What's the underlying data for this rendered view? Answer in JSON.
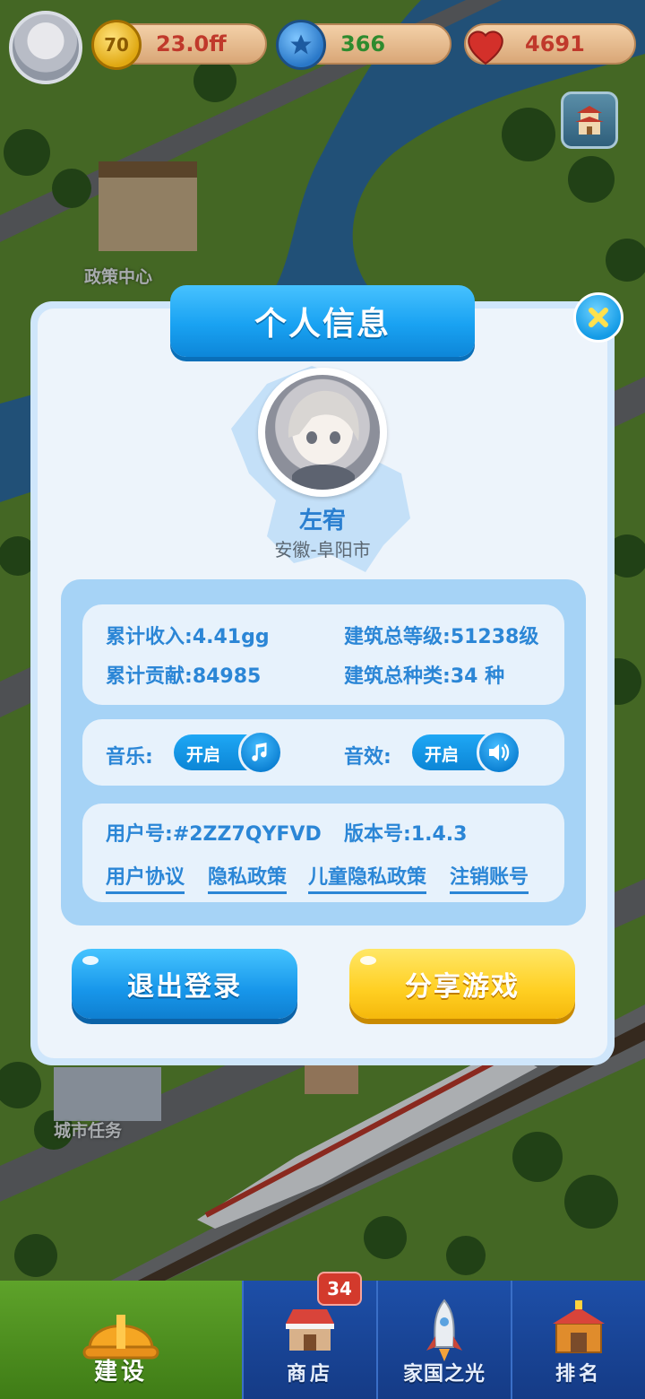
{
  "top_bar": {
    "coins": "23.0ff",
    "coin_icon_label": "70",
    "stars": "366",
    "hearts": "4691",
    "colors": {
      "coins": "#c0392b",
      "stars": "#2e8b2e",
      "hearts": "#c0392b"
    }
  },
  "map_labels": {
    "policy_center": "政策中心",
    "city_tasks": "城市任务"
  },
  "dialog": {
    "title": "个人信息",
    "player_name": "左宥",
    "location": "安徽-阜阳市",
    "stats": {
      "income_label": "累计收入:",
      "income_value": "4.41gg",
      "building_level_label": "建筑总等级:",
      "building_level_value": "51238级",
      "contribution_label": "累计贡献:",
      "contribution_value": "84985",
      "building_types_label": "建筑总种类:",
      "building_types_value": "34 种"
    },
    "settings": {
      "music_label": "音乐:",
      "music_state": "开启",
      "sfx_label": "音效:",
      "sfx_state": "开启"
    },
    "account": {
      "user_id_label": "用户号:",
      "user_id": "#2ZZ7QYFVD",
      "version_label": "版本号:",
      "version": "1.4.3",
      "links": [
        "用户协议",
        "隐私政策",
        "儿童隐私政策",
        "注销账号"
      ]
    },
    "logout_button": "退出登录",
    "share_button": "分享游戏"
  },
  "bottom_nav": {
    "items": [
      {
        "label": "建设",
        "icon": "hard-hat-icon",
        "active": true
      },
      {
        "label": "商店",
        "icon": "shop-icon",
        "active": false
      },
      {
        "label": "家国之光",
        "icon": "rocket-icon",
        "active": false
      },
      {
        "label": "排名",
        "icon": "ranking-icon",
        "active": false
      }
    ],
    "shop_badge": "34"
  }
}
